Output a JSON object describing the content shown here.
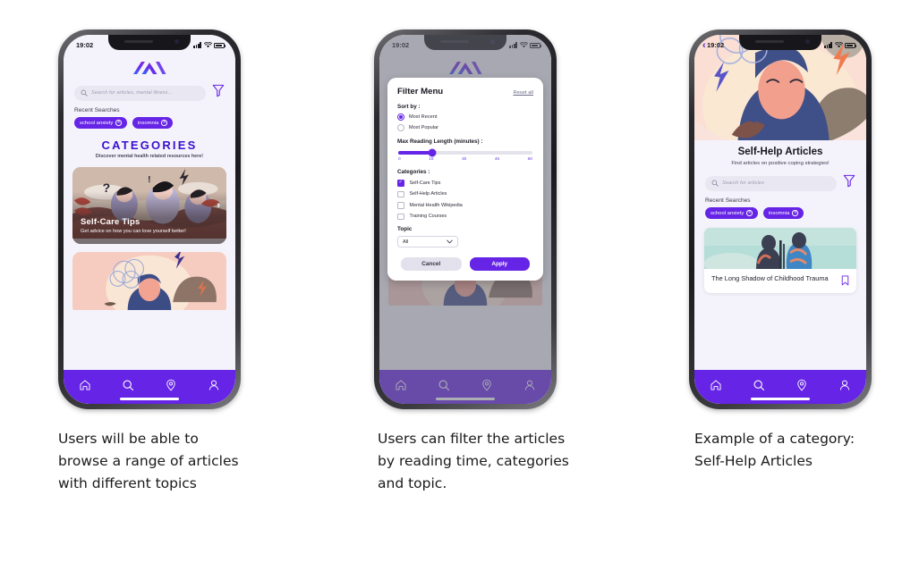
{
  "page": {
    "background": "#ffffff",
    "accent_purple": "#6624e6",
    "heading_purple": "#3b0fcf"
  },
  "phones": [
    {
      "id": "phone-browse",
      "status": {
        "time": "19:02"
      },
      "logo_name": "app-logo",
      "search": {
        "placeholder": "Search for articles, mental illness...",
        "value": ""
      },
      "recent_searches_label": "Recent Searches",
      "chips": [
        "school anxiety",
        "insomnia"
      ],
      "categories": {
        "title": "CATEGORIES",
        "subtitle": "Discover mental health related resources here!"
      },
      "cards": [
        {
          "title": "Self-Care Tips",
          "subtitle": "Get advice on how you can love yourself better!"
        },
        {
          "title": "",
          "subtitle": ""
        }
      ],
      "nav": [
        "home-icon",
        "search-icon",
        "location-icon",
        "profile-icon"
      ]
    },
    {
      "id": "phone-filter",
      "status": {
        "time": "19:02"
      },
      "dialog": {
        "title": "Filter Menu",
        "reset_label": "Reset all",
        "sort_label": "Sort by :",
        "sort_options": [
          {
            "label": "Most Recent",
            "selected": true
          },
          {
            "label": "Most Popular",
            "selected": false
          }
        ],
        "reading_label": "Max Reading Length (minutes) :",
        "slider": {
          "value": 15,
          "min": 0,
          "max": 60,
          "ticks": [
            "0",
            "15",
            "30",
            "45",
            "60"
          ]
        },
        "categories_label": "Categories :",
        "categories": [
          {
            "label": "Self-Care Tips",
            "checked": true
          },
          {
            "label": "Self-Help Articles",
            "checked": false
          },
          {
            "label": "Mental Health Wikipedia",
            "checked": false
          },
          {
            "label": "Training Courses",
            "checked": false
          }
        ],
        "topic_label": "Topic",
        "topic_value": "All",
        "cancel_label": "Cancel",
        "apply_label": "Apply"
      },
      "nav": [
        "home-icon",
        "search-icon",
        "location-icon",
        "profile-icon"
      ]
    },
    {
      "id": "phone-category",
      "status": {
        "time": "19:02"
      },
      "title": "Self-Help Articles",
      "subtitle": "Find articles on positive coping strategies!",
      "search": {
        "placeholder": "Search for articles",
        "value": ""
      },
      "recent_searches_label": "Recent Searches",
      "chips": [
        "school anxiety",
        "insomnia"
      ],
      "article": {
        "title": "The Long Shadow of Childhood Trauma",
        "bookmark_icon": "bookmark-icon"
      },
      "nav": [
        "home-icon",
        "search-icon",
        "location-icon",
        "profile-icon"
      ]
    }
  ],
  "captions": [
    "Users will be able to browse a range of articles with different topics",
    "Users can filter the articles by reading time, categories and topic.",
    "Example of a category: Self-Help Articles"
  ]
}
